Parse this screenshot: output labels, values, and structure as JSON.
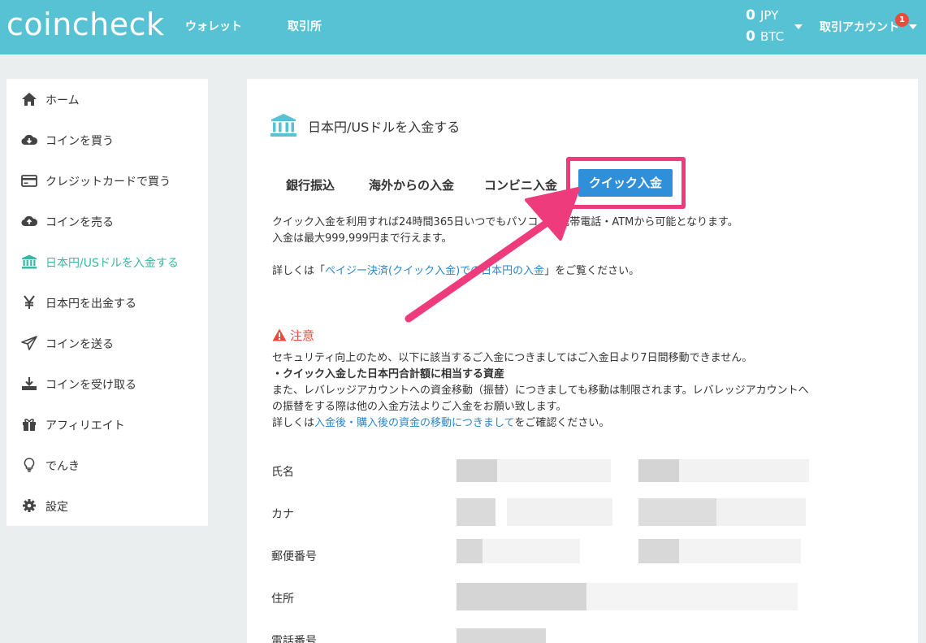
{
  "header": {
    "logo": "coincheck",
    "nav": [
      "ウォレット",
      "取引所"
    ],
    "balances": [
      {
        "amount": "0",
        "currency": "JPY"
      },
      {
        "amount": "0",
        "currency": "BTC"
      }
    ],
    "account_label": "取引アカウント",
    "notification_count": "1",
    "brand_color": "#56c2d4"
  },
  "sidebar": {
    "items": [
      {
        "label": "ホーム",
        "icon": "home-icon"
      },
      {
        "label": "コインを買う",
        "icon": "cloud-download-icon"
      },
      {
        "label": "クレジットカードで買う",
        "icon": "credit-card-icon"
      },
      {
        "label": "コインを売る",
        "icon": "cloud-upload-icon"
      },
      {
        "label": "日本円/USドルを入金する",
        "icon": "bank-icon",
        "active": true
      },
      {
        "label": "日本円を出金する",
        "icon": "yen-icon"
      },
      {
        "label": "コインを送る",
        "icon": "send-icon"
      },
      {
        "label": "コインを受け取る",
        "icon": "download-icon"
      },
      {
        "label": "アフィリエイト",
        "icon": "gift-icon"
      },
      {
        "label": "でんき",
        "icon": "lightbulb-icon"
      },
      {
        "label": "設定",
        "icon": "gear-icon"
      }
    ],
    "active_color": "#36b9a4"
  },
  "main": {
    "title": "日本円/USドルを入金する",
    "tabs": [
      "銀行振込",
      "海外からの入金",
      "コンビニ入金",
      "クイック入金"
    ],
    "active_tab": "クイック入金",
    "desc_line1": "クイック入金を利用すれば24時間365日いつでもパソコン・携帯電話・ATMから可能となります。",
    "desc_line2": "入金は最大999,999円まで行えます。",
    "detail_prefix": "詳しくは「",
    "detail_link": "ペイジー決済(クイック入金)での日本円の入金",
    "detail_suffix": "」をご覧ください。",
    "notice": {
      "title": "注意",
      "line1": "セキュリティ向上のため、以下に該当するご入金につきましてはご入金日より7日間移動できません。",
      "line2": "・クイック入金した日本円合計額に相当する資産",
      "line3": "また、レバレッジアカウントへの資金移動（振替）につきましても移動は制限されます。レバレッジアカウントへ",
      "line4": "の振替をする際は他の入金方法よりご入金をお願い致します。",
      "line5_prefix": "詳しくは",
      "line5_link": "入金後・購入後の資金の移動につきまして",
      "line5_suffix": "をご確認ください。"
    },
    "fields": [
      "氏名",
      "カナ",
      "郵便番号",
      "住所",
      "電話番号"
    ],
    "highlight_color": "#ee3b7c",
    "button_color": "#2f8fd8",
    "warning_color": "#e74c3c",
    "link_color": "#2a86c9"
  }
}
